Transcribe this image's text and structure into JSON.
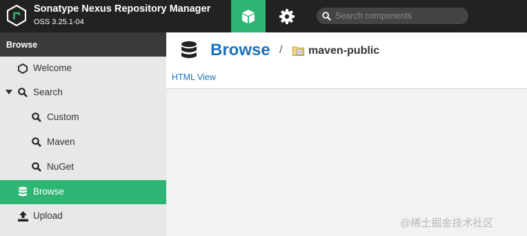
{
  "header": {
    "app_title": "Sonatype Nexus Repository Manager",
    "app_version": "OSS 3.25.1-04",
    "search_placeholder": "Search components",
    "brand_color": "#2fb573",
    "header_color": "#222222"
  },
  "sidebar": {
    "title": "Browse",
    "items": [
      {
        "label": "Welcome",
        "icon": "hexagon-icon"
      },
      {
        "label": "Search",
        "icon": "search-icon",
        "expanded": true
      },
      {
        "label": "Custom",
        "icon": "search-icon"
      },
      {
        "label": "Maven",
        "icon": "search-icon"
      },
      {
        "label": "NuGet",
        "icon": "search-icon"
      },
      {
        "label": "Browse",
        "icon": "database-icon",
        "active": true
      },
      {
        "label": "Upload",
        "icon": "upload-icon"
      }
    ]
  },
  "main": {
    "title": "Browse",
    "separator": "/",
    "repository": "maven-public",
    "html_view_label": "HTML View",
    "link_color": "#1a73bd"
  },
  "watermark": "@稀土掘金技术社区"
}
